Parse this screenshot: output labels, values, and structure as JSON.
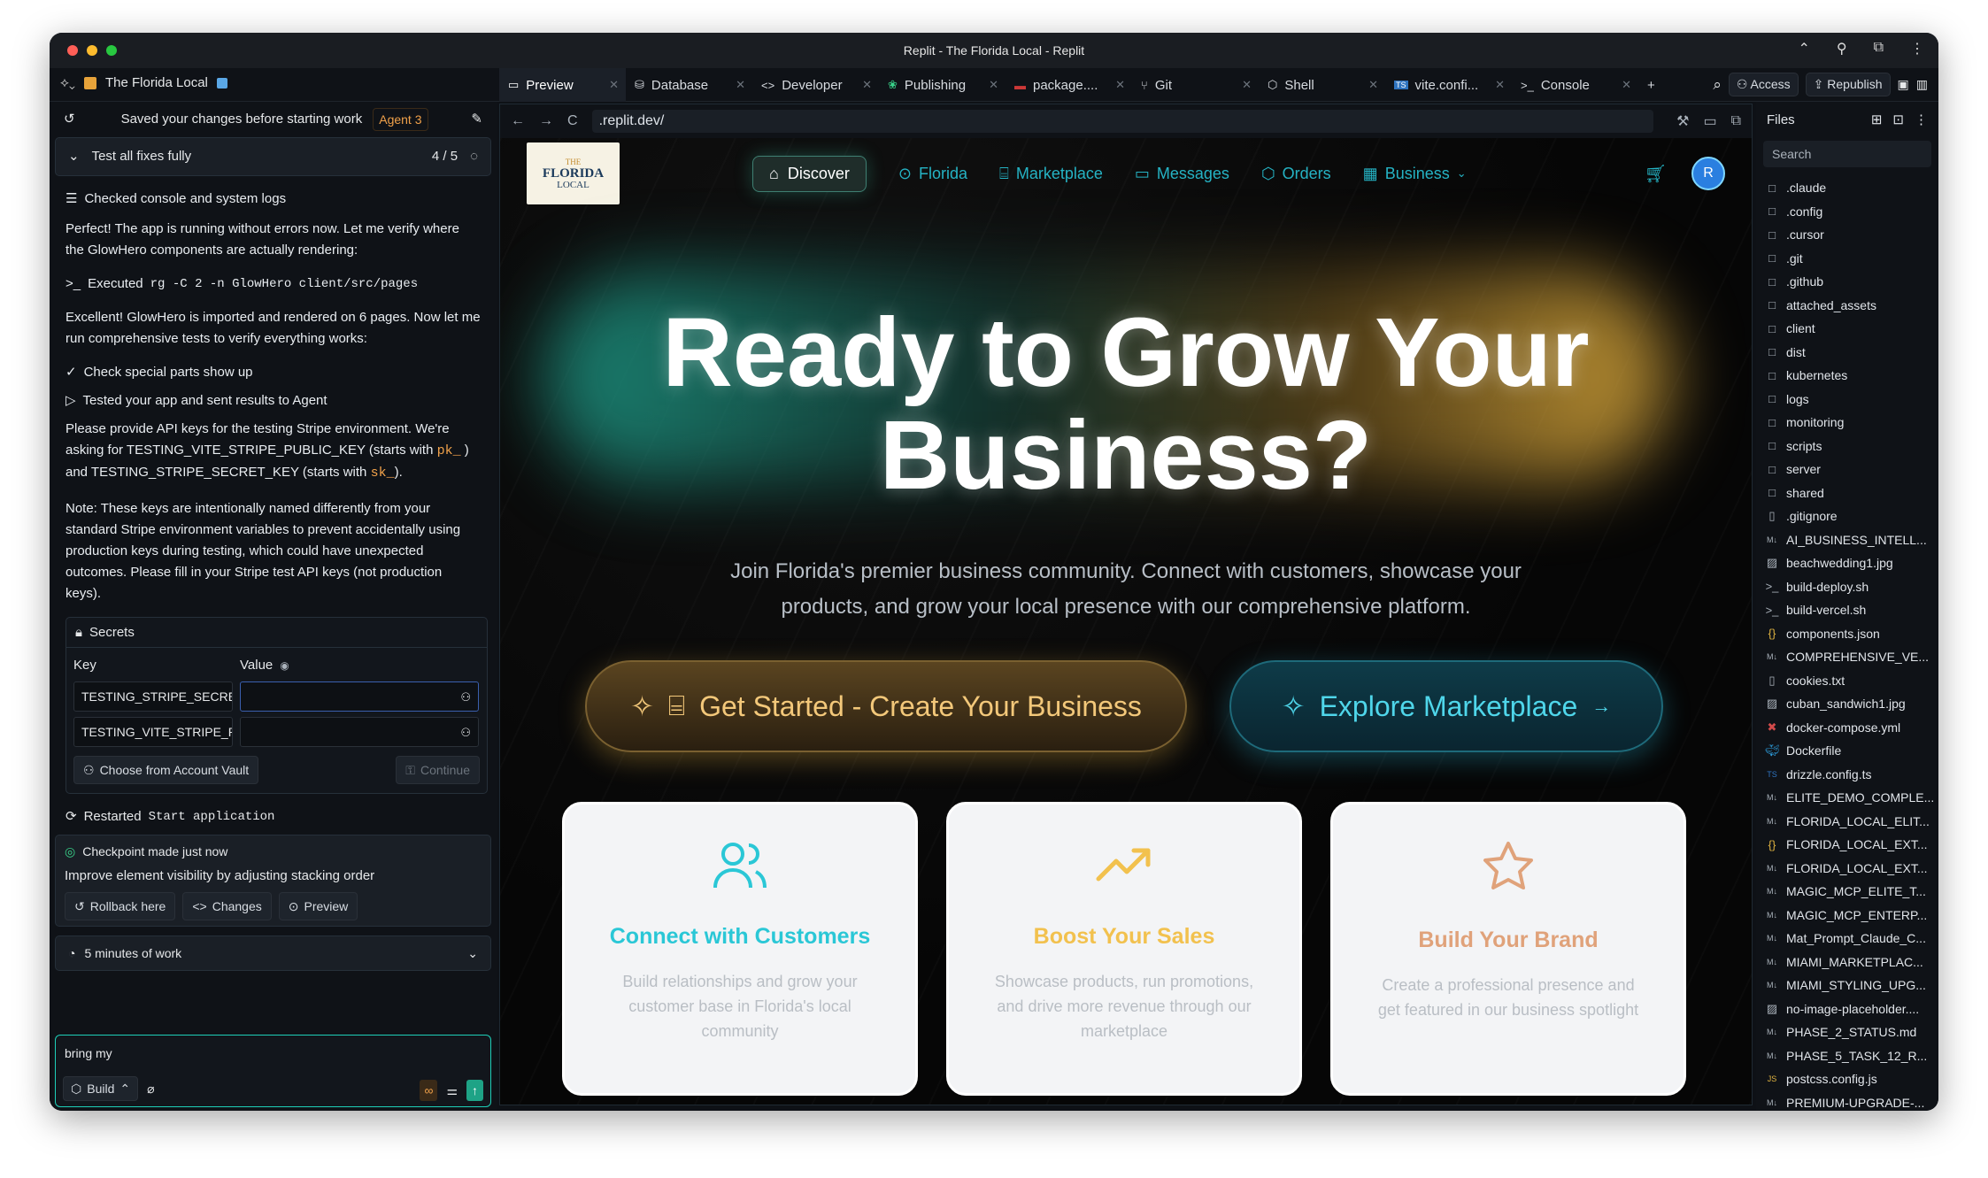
{
  "window_title": "Replit - The Florida Local - Replit",
  "project_name": "The Florida Local",
  "tabs": [
    {
      "label": "Preview",
      "icon": "monitor-icon",
      "active": true
    },
    {
      "label": "Database",
      "icon": "database-icon"
    },
    {
      "label": "Developer",
      "icon": "code-icon"
    },
    {
      "label": "Publishing",
      "icon": "publish-icon"
    },
    {
      "label": "package....",
      "icon": "npm-icon"
    },
    {
      "label": "Git",
      "icon": "git-icon"
    },
    {
      "label": "Shell",
      "icon": "shell-icon"
    },
    {
      "label": "vite.confi...",
      "icon": "ts-file-icon"
    },
    {
      "label": "Console",
      "icon": "console-icon"
    }
  ],
  "top_right": {
    "access": "Access",
    "republish": "Republish"
  },
  "agent_panel": {
    "saved_msg": "Saved your changes before starting work",
    "agent_badge": "Agent 3",
    "task_title": "Test all fixes fully",
    "task_progress": "4 / 5",
    "checked_logs": "Checked console and system logs",
    "msg1": "Perfect! The app is running without errors now. Let me verify where the GlowHero components are actually rendering:",
    "executed_prefix": "Executed",
    "executed_cmd": "rg -C 2 -n GlowHero client/src/pages",
    "msg2": "Excellent! GlowHero is imported and rendered on 6 pages. Now let me run comprehensive tests to verify everything works:",
    "check_special": "Check special parts show up",
    "tested_app": "Tested your app and sent results to Agent",
    "msg3_a": "Please provide API keys for the testing Stripe environment. We're asking for TESTING_VITE_STRIPE_PUBLIC_KEY (starts with",
    "msg3_pk": "pk_",
    "msg3_b": ") and TESTING_STRIPE_SECRET_KEY (starts with",
    "msg3_sk": "sk_",
    "msg3_c": ").",
    "note": "Note: These keys are intentionally named differently from your standard Stripe environment variables to prevent accidentally using production keys during testing, which could have unexpected outcomes. Please fill in your Stripe test API keys (not production keys).",
    "secrets_title": "Secrets",
    "key_label": "Key",
    "value_label": "Value",
    "key1": "TESTING_STRIPE_SECRET_KEY",
    "key2": "TESTING_VITE_STRIPE_PUBLIC_KEY",
    "vault_btn": "Choose from Account Vault",
    "continue_btn": "Continue",
    "restarted_prefix": "Restarted",
    "restarted_name": "Start application",
    "checkpoint": "Checkpoint made just now",
    "checkpoint_desc": "Improve element visibility by adjusting stacking order",
    "rollback": "Rollback here",
    "changes": "Changes",
    "preview_btn": "Preview",
    "work_time": "5 minutes of work",
    "input_value": "bring my",
    "build_btn": "Build"
  },
  "url": ".replit.dev/",
  "site": {
    "logo_top": "THE",
    "logo_main": "FLORIDA",
    "logo_bottom": "LOCAL",
    "nav": [
      "Discover",
      "Florida",
      "Marketplace",
      "Messages",
      "Orders",
      "Business"
    ],
    "avatar": "R",
    "headline_1": "Ready to Grow Your",
    "headline_2": "Business?",
    "subtitle": "Join Florida's premier business community. Connect with customers, showcase your products, and grow your local presence with our comprehensive platform.",
    "cta_primary": "Get Started - Create Your Business",
    "cta_secondary": "Explore Marketplace",
    "cards": [
      {
        "title": "Connect with Customers",
        "desc": "Build relationships and grow your customer base in Florida's local community",
        "color": "#2ac7d6"
      },
      {
        "title": "Boost Your Sales",
        "desc": "Showcase products, run promotions, and drive more revenue through our marketplace",
        "color": "#f2c14e"
      },
      {
        "title": "Build Your Brand",
        "desc": "Create a professional presence and get featured in our business spotlight",
        "color": "#e0a27a"
      }
    ]
  },
  "files": {
    "title": "Files",
    "search_placeholder": "Search",
    "items": [
      {
        "name": ".claude",
        "type": "folder"
      },
      {
        "name": ".config",
        "type": "folder"
      },
      {
        "name": ".cursor",
        "type": "folder"
      },
      {
        "name": ".git",
        "type": "folder"
      },
      {
        "name": ".github",
        "type": "folder"
      },
      {
        "name": "attached_assets",
        "type": "folder"
      },
      {
        "name": "client",
        "type": "folder"
      },
      {
        "name": "dist",
        "type": "folder"
      },
      {
        "name": "kubernetes",
        "type": "folder"
      },
      {
        "name": "logs",
        "type": "folder"
      },
      {
        "name": "monitoring",
        "type": "folder"
      },
      {
        "name": "scripts",
        "type": "folder"
      },
      {
        "name": "server",
        "type": "folder"
      },
      {
        "name": "shared",
        "type": "folder"
      },
      {
        "name": ".gitignore",
        "type": "file"
      },
      {
        "name": "AI_BUSINESS_INTELL...",
        "type": "md"
      },
      {
        "name": "beachwedding1.jpg",
        "type": "image"
      },
      {
        "name": "build-deploy.sh",
        "type": "shell"
      },
      {
        "name": "build-vercel.sh",
        "type": "shell"
      },
      {
        "name": "components.json",
        "type": "json"
      },
      {
        "name": "COMPREHENSIVE_VE...",
        "type": "md"
      },
      {
        "name": "cookies.txt",
        "type": "file"
      },
      {
        "name": "cuban_sandwich1.jpg",
        "type": "image"
      },
      {
        "name": "docker-compose.yml",
        "type": "yaml"
      },
      {
        "name": "Dockerfile",
        "type": "docker"
      },
      {
        "name": "drizzle.config.ts",
        "type": "ts"
      },
      {
        "name": "ELITE_DEMO_COMPLE...",
        "type": "md"
      },
      {
        "name": "FLORIDA_LOCAL_ELIT...",
        "type": "md"
      },
      {
        "name": "FLORIDA_LOCAL_EXT...",
        "type": "json"
      },
      {
        "name": "FLORIDA_LOCAL_EXT...",
        "type": "md"
      },
      {
        "name": "MAGIC_MCP_ELITE_T...",
        "type": "md"
      },
      {
        "name": "MAGIC_MCP_ENTERP...",
        "type": "md"
      },
      {
        "name": "Mat_Prompt_Claude_C...",
        "type": "md"
      },
      {
        "name": "MIAMI_MARKETPLAC...",
        "type": "md"
      },
      {
        "name": "MIAMI_STYLING_UPG...",
        "type": "md"
      },
      {
        "name": "no-image-placeholder....",
        "type": "image"
      },
      {
        "name": "PHASE_2_STATUS.md",
        "type": "md"
      },
      {
        "name": "PHASE_5_TASK_12_R...",
        "type": "md"
      },
      {
        "name": "postcss.config.js",
        "type": "js"
      },
      {
        "name": "PREMIUM-UPGRADE-...",
        "type": "md"
      }
    ]
  }
}
